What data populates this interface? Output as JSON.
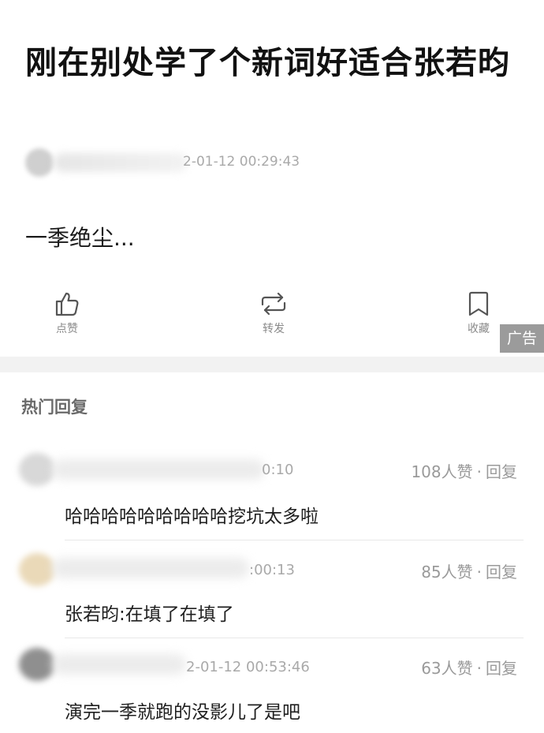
{
  "post": {
    "title": "刚在别处学了个新词好适合张若昀",
    "time": "2-01-12 00:29:43",
    "body": "一季绝尘..."
  },
  "actions": {
    "like_label": "点赞",
    "share_label": "转发",
    "favorite_label": "收藏"
  },
  "ad_label": "广告",
  "comments_section": {
    "title": "热门回复",
    "items": [
      {
        "time": "0:10",
        "likes": "108人赞",
        "separator": "·",
        "reply_label": "回复",
        "text": "哈哈哈哈哈哈哈哈哈挖坑太多啦"
      },
      {
        "time": ":00:13",
        "likes": "85人赞",
        "separator": "·",
        "reply_label": "回复",
        "text": "张若昀:在填了在填了"
      },
      {
        "time": "2-01-12 00:53:46",
        "likes": "63人赞",
        "separator": "·",
        "reply_label": "回复",
        "text": "演完一季就跑的没影儿了是吧"
      }
    ]
  },
  "icons": {
    "like": "thumbs-up-icon",
    "share": "repost-icon",
    "favorite": "bookmark-icon"
  },
  "colors": {
    "text_primary": "#111111",
    "text_secondary": "#a9a9a9",
    "ad_background": "#9b9b9b",
    "section_gap": "#f2f2f2"
  }
}
